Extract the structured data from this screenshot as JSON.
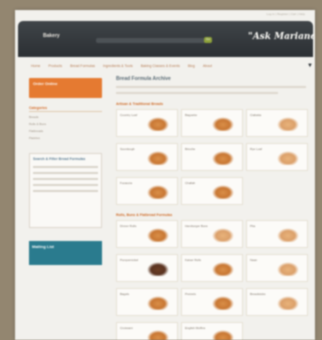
{
  "header": {
    "top_links": "Log in | Register | Cart | Help",
    "logo": "Bakery",
    "go_label": "Go",
    "slogan": "\"Ask Mariano\""
  },
  "nav": {
    "items": [
      "Home",
      "Products",
      "Bread Formulas",
      "Ingredients & Tools",
      "Baking Classes & Events",
      "Blog",
      "About"
    ]
  },
  "sidebar": {
    "promo": "Order Online",
    "title": "Categories",
    "links": [
      "Breads",
      "Rolls & Buns",
      "Flatbreads",
      "Pastries"
    ],
    "box2_title": "Search & Filter Bread Formulas",
    "box3_title": "Mailing List"
  },
  "main": {
    "title": "Bread Formula Archive",
    "section1_title": "Artisan & Traditional Breads",
    "section2_title": "Rolls, Buns & Flatbread Formulas",
    "section1_products": [
      {
        "name": "Country Loaf",
        "img": "bread"
      },
      {
        "name": "Baguette",
        "img": "bread"
      },
      {
        "name": "Ciabatta",
        "img": "pale"
      },
      {
        "name": "Sourdough",
        "img": "bread"
      },
      {
        "name": "Brioche",
        "img": "bread"
      },
      {
        "name": "Rye Loaf",
        "img": "pale"
      },
      {
        "name": "Focaccia",
        "img": "bread"
      },
      {
        "name": "Challah",
        "img": "bread"
      }
    ],
    "section2_products": [
      {
        "name": "Dinner Rolls",
        "img": "bread"
      },
      {
        "name": "Hamburger Buns",
        "img": "pale"
      },
      {
        "name": "Pita",
        "img": "pale"
      },
      {
        "name": "Pumpernickel",
        "img": "dark"
      },
      {
        "name": "Kaiser Rolls",
        "img": "bread"
      },
      {
        "name": "Naan",
        "img": "pale"
      },
      {
        "name": "Bagels",
        "img": "bread"
      },
      {
        "name": "Pretzels",
        "img": "bread"
      },
      {
        "name": "Breadsticks",
        "img": "pale"
      },
      {
        "name": "Croissant",
        "img": "bread"
      },
      {
        "name": "English Muffins",
        "img": "bread"
      }
    ]
  }
}
